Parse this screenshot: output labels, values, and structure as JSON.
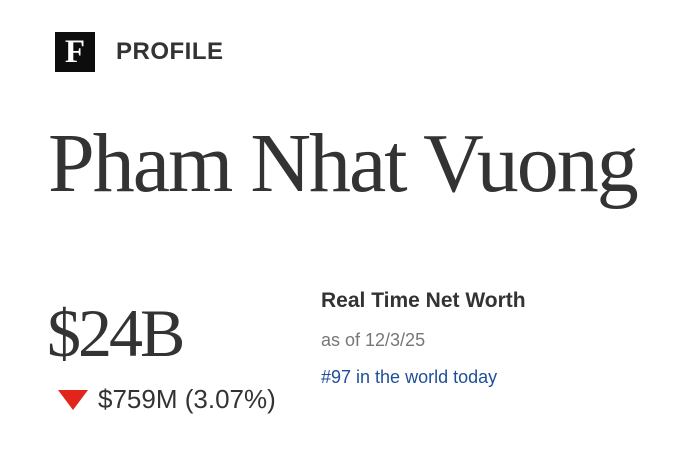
{
  "header": {
    "logo_letter": "F",
    "section_label": "PROFILE"
  },
  "profile": {
    "name": "Pham Nhat Vuong",
    "net_worth": "$24B",
    "change": "$759M (3.07%)",
    "change_direction": "down",
    "change_color": "#e1251b"
  },
  "real_time": {
    "title": "Real Time Net Worth",
    "as_of": "as of 12/3/25",
    "rank_link": "#97 in the world today"
  }
}
